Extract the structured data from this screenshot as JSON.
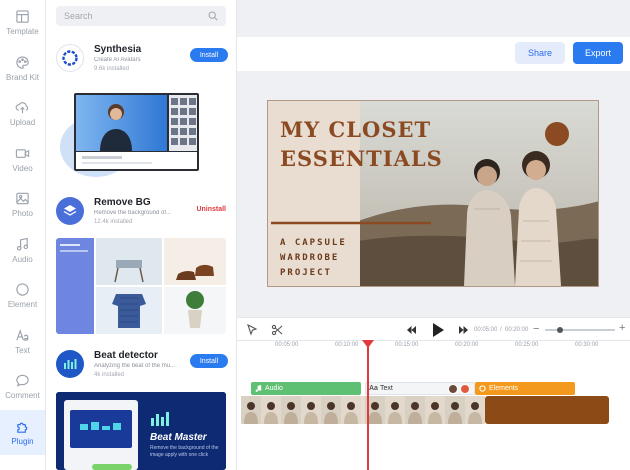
{
  "rail": {
    "items": [
      {
        "label": "Template",
        "icon": "template-icon"
      },
      {
        "label": "Brand Kit",
        "icon": "palette-icon"
      },
      {
        "label": "Upload",
        "icon": "upload-icon"
      },
      {
        "label": "Video",
        "icon": "video-icon"
      },
      {
        "label": "Photo",
        "icon": "photo-icon"
      },
      {
        "label": "Audio",
        "icon": "audio-icon"
      },
      {
        "label": "Element",
        "icon": "element-icon"
      },
      {
        "label": "Text",
        "icon": "text-icon"
      },
      {
        "label": "Comment",
        "icon": "comment-icon"
      },
      {
        "label": "Plugin",
        "icon": "plugin-icon",
        "active": true
      }
    ]
  },
  "panel": {
    "search": {
      "placeholder": "Search"
    },
    "plugins": [
      {
        "name": "Synthesia",
        "desc": "Create AI Avatars",
        "installs": "9.6k installed",
        "action": "Install"
      },
      {
        "name": "Remove BG",
        "desc": "Remove the background of...",
        "installs": "12.4k installed",
        "action": "Uninstall"
      },
      {
        "name": "Beat detector",
        "desc": "Analyzing the beat of the mu...",
        "installs": "4k installed",
        "action": "Install"
      }
    ],
    "beat_preview": {
      "title": "Beat Master",
      "desc": "Remove the background of the image apply with one click"
    }
  },
  "header": {
    "share": "Share",
    "export": "Export"
  },
  "canvas": {
    "title_line1": "MY CLOSET",
    "title_line2": "ESSENTIALS",
    "sub_line1": "A CAPSULE",
    "sub_line2": "WARDROBE",
    "sub_line3": "PROJECT"
  },
  "timeline": {
    "current_time": "00:05:00",
    "total_time": "00:20:00",
    "ruler_ticks": [
      "00:05:00",
      "00:10:00",
      "00:15:00",
      "00:20:00",
      "00:25:00",
      "00:30:00"
    ],
    "tracks": {
      "audio": "Audio",
      "text": "Text",
      "elements": "Elements"
    }
  },
  "colors": {
    "accent": "#2b7bf0",
    "audio_track": "#5fbf72",
    "element_track": "#f39a1e",
    "canvas_title": "#8b4a22"
  }
}
